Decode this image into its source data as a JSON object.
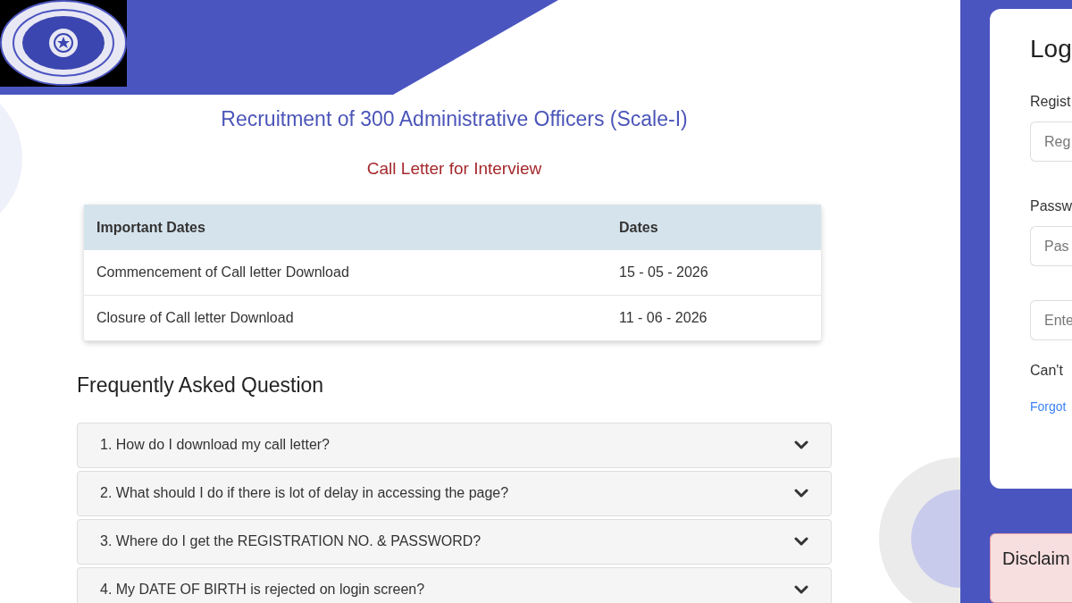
{
  "page": {
    "title": "Recruitment of 300 Administrative Officers (Scale-I)",
    "subtitle": "Call Letter for Interview"
  },
  "dates_table": {
    "columns": [
      "Important Dates",
      "Dates"
    ],
    "rows": [
      [
        "Commencement of Call letter Download",
        "15 - 05 - 2026"
      ],
      [
        "Closure of Call letter Download",
        "11 - 06 - 2026"
      ]
    ]
  },
  "faq": {
    "heading": "Frequently Asked Question",
    "items": [
      {
        "question": "1. How do I download my call letter?",
        "expanded": false
      },
      {
        "question": "2. What should I do if there is lot of delay in accessing the page?",
        "expanded": false
      },
      {
        "question": "3. Where do I get the REGISTRATION NO. & PASSWORD?",
        "expanded": false
      },
      {
        "question": "4. My DATE OF BIRTH is rejected on login screen?",
        "expanded": false
      }
    ]
  },
  "login": {
    "heading": "Log",
    "fields": [
      {
        "label": "Regist",
        "placeholder": "Reg"
      },
      {
        "label": "Passw",
        "placeholder": "Pas"
      },
      {
        "placeholder": "Ente"
      }
    ],
    "help_text": "Can't",
    "link": "Forgot"
  },
  "disclaimer": {
    "heading": "Disclaim"
  }
}
